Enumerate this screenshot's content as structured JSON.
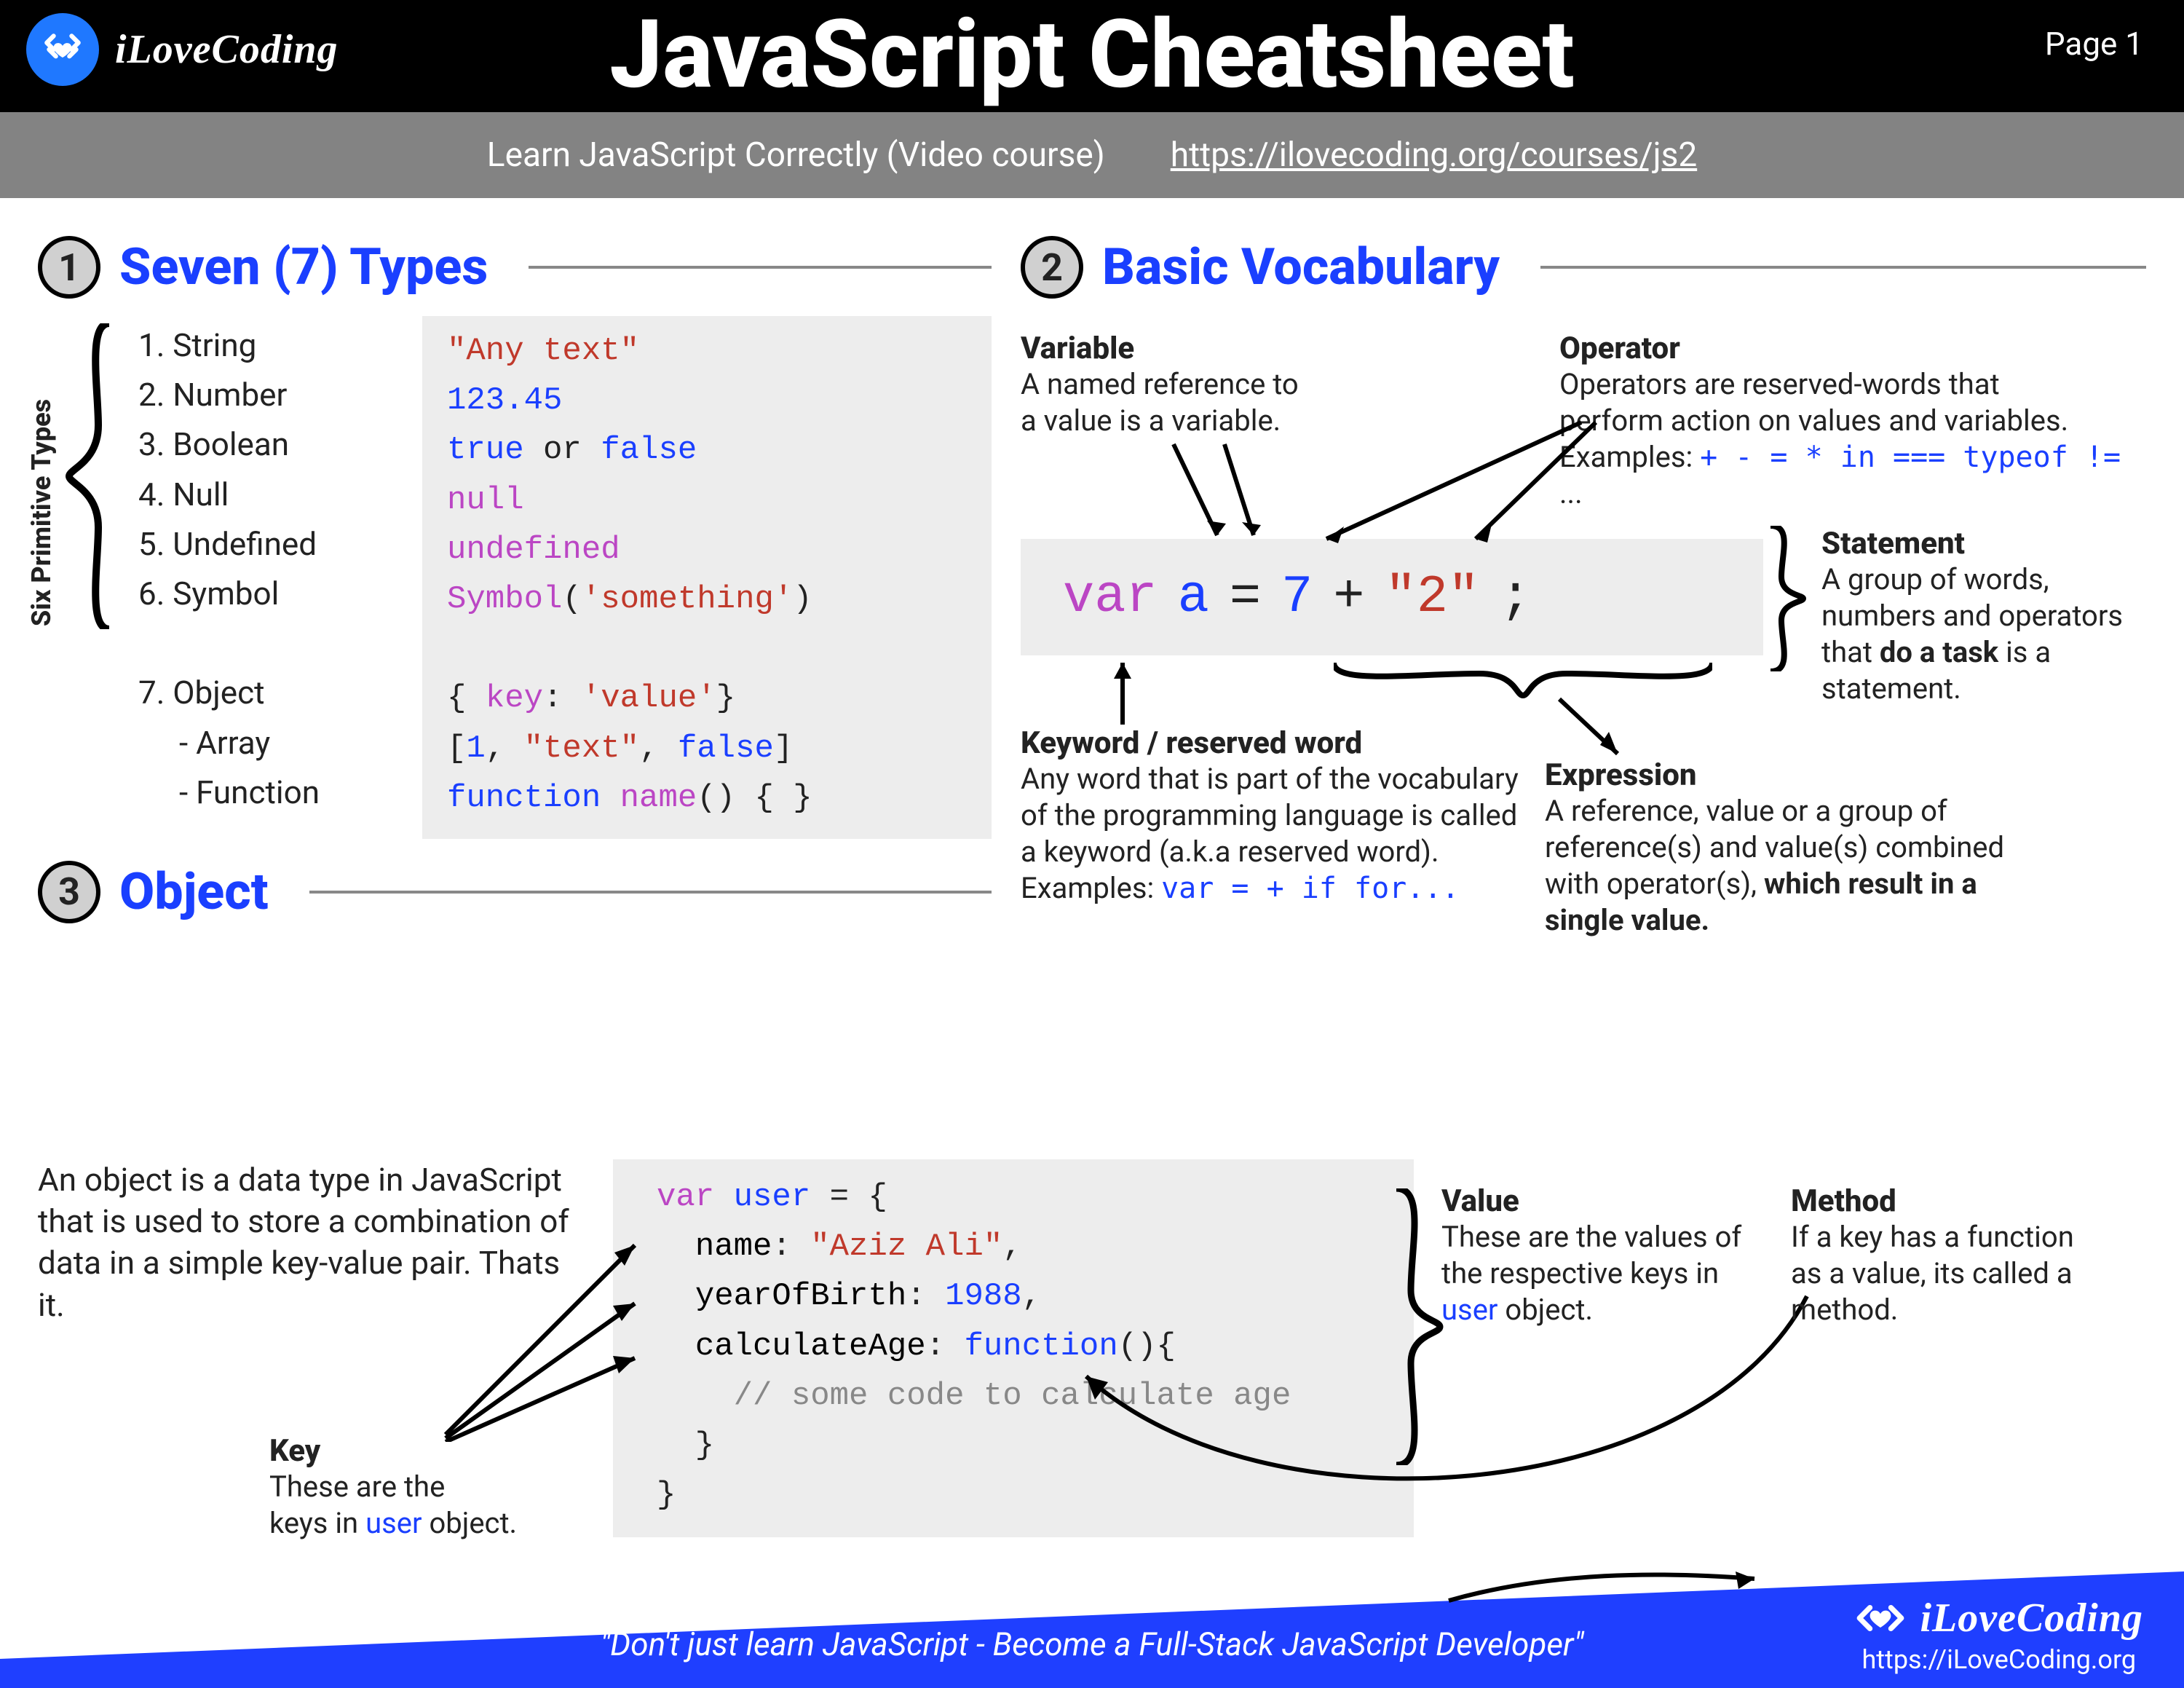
{
  "header": {
    "brand": "iLoveCoding",
    "title": "JavaScript Cheatsheet",
    "page": "Page 1"
  },
  "subhead": {
    "text": "Learn JavaScript Correctly (Video course)",
    "url": "https://ilovecoding.org/courses/js2"
  },
  "sections": {
    "s1": {
      "num": "1",
      "title": "Seven (7) Types"
    },
    "s2": {
      "num": "2",
      "title": "Basic Vocabulary"
    },
    "s3": {
      "num": "3",
      "title": "Object"
    }
  },
  "types": {
    "prim_label": "Six Primitive Types",
    "list": [
      "1.  String",
      "2.  Number",
      "3.  Boolean",
      "4.  Null",
      "5.  Undefined",
      "6.  Symbol",
      "",
      "7.  Object",
      " -  Array",
      " -  Function"
    ],
    "code_html": "<span class='c-red'>\"Any text\"</span>\n<span class='c-blue'>123.45</span>\n<span class='c-blue'>true</span> or <span class='c-blue'>false</span>\n<span class='c-purp'>null</span>\n<span class='c-purp'>undefined</span>\n<span class='c-purp'>Symbol</span>(<span class='c-red'>'something'</span>)\n\n{ <span class='c-purp'>key</span>: <span class='c-red'>'value'</span>}\n[<span class='c-blue'>1</span>, <span class='c-red'>\"text\"</span>, <span class='c-blue'>false</span>]\n<span class='c-blue'>function</span> <span class='c-purp'>name</span>() { }"
  },
  "vocab": {
    "variable": {
      "label": "Variable",
      "desc": "A named reference to\na value is a variable."
    },
    "operator": {
      "label": "Operator",
      "desc": "Operators are reserved-words that\nperform action on values and variables.",
      "examples": "Examples: + - = * in === typeof != ..."
    },
    "statement": {
      "label": "Statement",
      "desc": "A group of words, numbers and operators that do a task is a statement."
    },
    "keyword": {
      "label": "Keyword / reserved word",
      "desc": "Any word that is part of the vocabulary of the programming language is called a keyword (a.k.a reserved word).",
      "examples": "Examples: var = + if for..."
    },
    "expression": {
      "label": "Expression",
      "desc": "A reference, value or a group of reference(s) and value(s) combined with operator(s), which result in a single value."
    },
    "code": {
      "kw": "var",
      "name": "a",
      "eq": "=",
      "n": "7",
      "plus": "+",
      "str": "\"2\"",
      "semi": ";"
    }
  },
  "object": {
    "desc": "An object is a data type in JavaScript that is used to store a combination of data in a simple key-value pair. Thats it.",
    "code_html": "<span class='c-purp'>var</span> <span class='c-blue'>user</span> = {\n  <span class='c-black'>name</span>: <span class='c-red'>\"Aziz Ali\"</span>,\n  <span class='c-black'>yearOfBirth</span>: <span class='c-blue'>1988</span>,\n  <span class='c-black'>calculateAge</span>: <span class='c-blue'>function</span>(){\n    <span class='c-gray'>// some code to calculate age</span>\n  }\n}",
    "key": {
      "label": "Key",
      "desc": "These are the\nkeys in user object."
    },
    "value": {
      "label": "Value",
      "desc": "These are the values of the respective keys in user object."
    },
    "method": {
      "label": "Method",
      "desc": "If a key has a function as a value, its called a method."
    }
  },
  "footer": {
    "quote": "\"Don't just learn JavaScript - Become a Full-Stack JavaScript Developer\"",
    "brand": "iLoveCoding",
    "url": "https://iLoveCoding.org"
  }
}
